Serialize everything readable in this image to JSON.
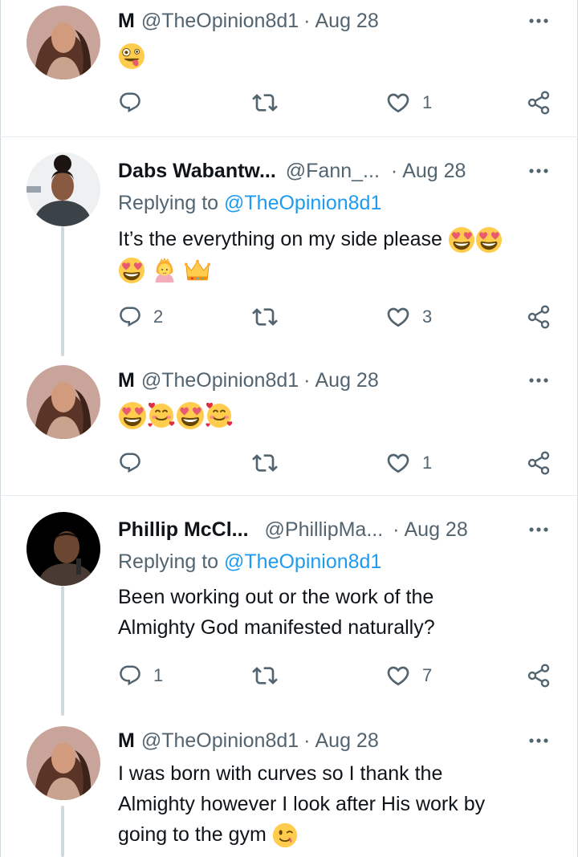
{
  "tweets": [
    {
      "name": "M",
      "handle": "@TheOpinion8d1",
      "dot": "·",
      "date": "Aug 28",
      "replying_prefix": "",
      "replying_to": "",
      "text": "",
      "emojis": [
        "zany-face-emoji"
      ],
      "reply_count": "",
      "retweet_count": "",
      "like_count": "1"
    },
    {
      "name": "Dabs Wabantw...",
      "handle": "@Fann_...",
      "dot": "·",
      "date": "Aug 28",
      "replying_prefix": "Replying to",
      "replying_to": "@TheOpinion8d1",
      "text": "It’s the everything on my side please",
      "emojis": [
        "heart-eyes-emoji",
        "heart-eyes-emoji",
        "heart-eyes-emoji",
        "princess-emoji",
        "crown-emoji"
      ],
      "reply_count": "2",
      "retweet_count": "",
      "like_count": "3"
    },
    {
      "name": "M",
      "handle": "@TheOpinion8d1",
      "dot": "·",
      "date": "Aug 28",
      "replying_prefix": "",
      "replying_to": "",
      "text": "",
      "emojis": [
        "heart-eyes-emoji",
        "smiling-face-with-hearts-emoji",
        "heart-eyes-emoji",
        "smiling-face-with-hearts-emoji"
      ],
      "reply_count": "",
      "retweet_count": "",
      "like_count": "1"
    },
    {
      "name": "Phillip McCl...",
      "handle": "@PhillipMa...",
      "dot": "·",
      "date": "Aug 28",
      "replying_prefix": "Replying to",
      "replying_to": "@TheOpinion8d1",
      "text_line1": "Been working out or the work of the",
      "text_line2": "Almighty God manifested naturally?",
      "reply_count": "1",
      "retweet_count": "",
      "like_count": "7"
    },
    {
      "name": "M",
      "handle": "@TheOpinion8d1",
      "dot": "·",
      "date": "Aug 28",
      "text_line1": "I was born with curves so I thank the",
      "text_line2": "Almighty however I look after His work by",
      "text_line3": "going to the gym",
      "emojis": [
        "winking-face-emoji"
      ]
    }
  ],
  "colors": {
    "text": "#0f1419",
    "secondary": "#536471",
    "link": "#1d9bf0",
    "divider": "#e6ecf0",
    "thread_line": "#cfd9de"
  }
}
